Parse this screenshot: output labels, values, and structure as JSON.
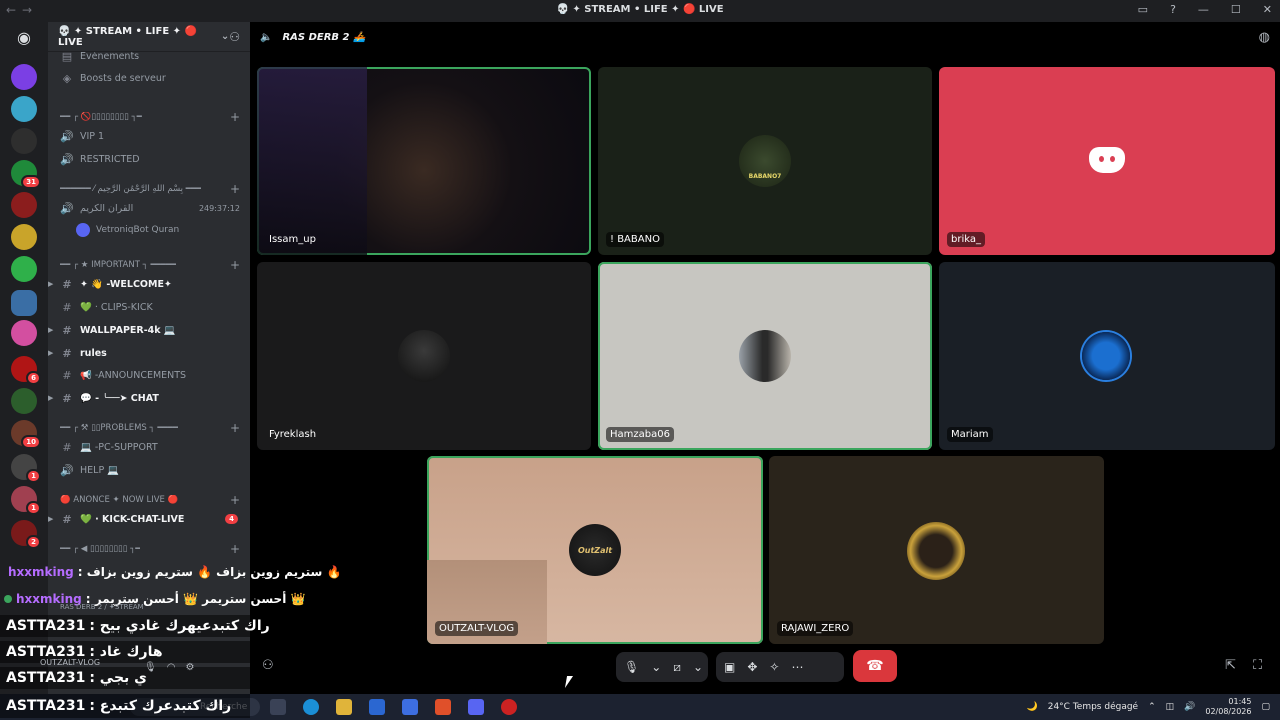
{
  "titlebar": {
    "title": "💀 ✦ STREAM • LIFE ✦ 🔴 LIVE"
  },
  "colors": {
    "accent": "#5865f2",
    "speaking": "#3ba55d",
    "danger": "#da373c",
    "mention": "#f23f43"
  },
  "server": {
    "name": "💀 ✦ STREAM • LIFE ✦ 🔴 LIVE"
  },
  "sidebar": {
    "events": "Événements",
    "boosts": "Boosts de serveur",
    "cat1": "━━ ┌ 🚫▯▯▯▯▯▯▯▯ ┐━",
    "vip": "VIP 1",
    "restricted": "RESTRICTED",
    "cat2": "━━━━━━ ⁄ بِسْمِ اللَّهِ الرَّحْمَٰنِ الرَّحِيمِ ━━━",
    "quran": "القرآن الكريم",
    "quran_timer": "249:37:12",
    "quran_user": "VetroniqBot Quran",
    "cat3": "━━ ┌ ★ IMPORTANT ┐ ━━━━━",
    "welcome": "✦ 👋 -WELCOME✦",
    "clips": "💚 · CLIPS-KICK",
    "wallpaper": "WALLPAPER-4k 💻",
    "rules": "rules",
    "announcements": "📢 -ANNOUNCEMENTS",
    "chat": "💬 - ╰──➤ CHAT",
    "cat4": "━━ ┌ ⚒ ▯▯PROBLEMS ┐ ━━━━",
    "pcsupport": "💻 -PC-SUPPORT",
    "help": "HELP 💻",
    "cat5": "🔴 ANONCE ✦ NOW LIVE 🔴",
    "kickchat": "💚 · KICK-CHAT-LIVE",
    "kickchat_mentions": "4",
    "cat6": "━━ ┌ ◀ ▯▯▯▯▯▯▯▯ ┐━"
  },
  "guild_badges": [
    "31",
    "6",
    "10",
    "1",
    "1",
    "2"
  ],
  "voice": {
    "channel": "RAS DERB 2 🚣",
    "tiles": [
      {
        "name": "Issam_up"
      },
      {
        "name": "! BABANO",
        "avatar_text": "BABANO7"
      },
      {
        "name": "brika_"
      },
      {
        "name": "Fyreklash"
      },
      {
        "name": "Hamzaba06"
      },
      {
        "name": "Mariam"
      },
      {
        "name": "OUTZALT-VLOG",
        "avatar_text": "OutZalt"
      },
      {
        "name": "RAJAWI_ZERO"
      }
    ]
  },
  "overlay_chat": [
    {
      "user": "hxxmking",
      "msg": ": ستريم زوين بزاف 🔥 ستريم زوين بزاف 🔥"
    },
    {
      "user": "hxxmking",
      "msg": ": أحسن ستريمر 👑 أحسن ستريمر 👑"
    },
    {
      "user": "ASTTA231",
      "msg": ": راك كتبدعيهرك غادي بيح"
    },
    {
      "user": "ASTTA231",
      "msg": ": هارك غاد"
    },
    {
      "user": "ASTTA231",
      "msg": ": ي بجي"
    },
    {
      "user": "ASTTA231",
      "msg": ": راك كتبدعرك كتبدع"
    }
  ],
  "user_panel": {
    "name": "OUTZALT-VLOG",
    "voice_status": "RAS DERB 2 / ✦STREAM"
  },
  "taskbar": {
    "search": "Recherche",
    "weather": "24°C  Temps dégagé",
    "time": "01:45",
    "date": "02/08/2026"
  }
}
